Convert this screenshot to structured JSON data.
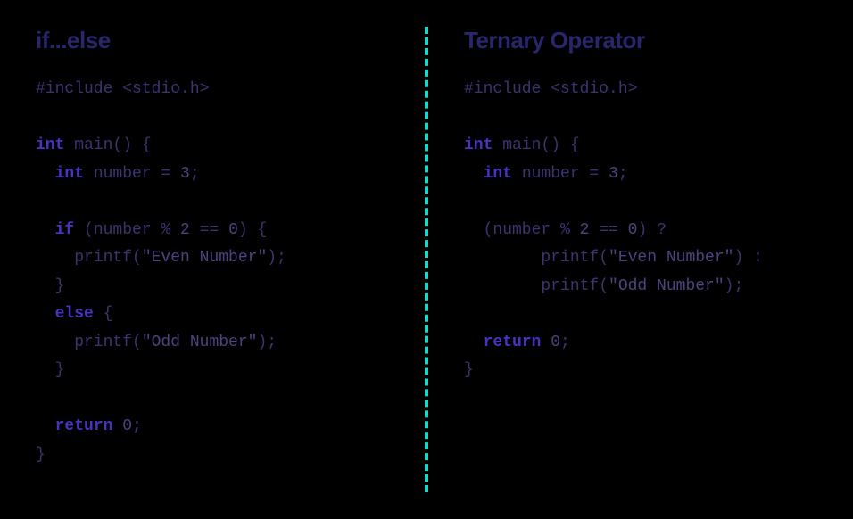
{
  "left": {
    "title": "if...else",
    "code": {
      "include": "#include <stdio.h>",
      "kw_int1": "int",
      "main_sig": " main() {",
      "kw_int2": "int",
      "var_decl": " number = ",
      "num_3": "3",
      "semi": ";",
      "kw_if": "if",
      "if_cond": " (number % ",
      "num_2": "2",
      "cond_mid": " == ",
      "num_0": "0",
      "cond_end": ") {",
      "printf1_a": "    printf(",
      "str_even": "\"Even Number\"",
      "printf1_b": ");",
      "close_if": "  }",
      "kw_else": "else",
      "else_open": " {",
      "printf2_a": "    printf(",
      "str_odd": "\"Odd Number\"",
      "printf2_b": ");",
      "close_else": "  }",
      "kw_return": "return",
      "ret_val": " ",
      "num_0b": "0",
      "ret_end": ";",
      "close_main": "}"
    }
  },
  "right": {
    "title": "Ternary Operator",
    "code": {
      "include": "#include <stdio.h>",
      "kw_int1": "int",
      "main_sig": " main() {",
      "kw_int2": "int",
      "var_decl": " number = ",
      "num_3": "3",
      "semi": ";",
      "cond_open": "  (number % ",
      "num_2": "2",
      "cond_mid": " == ",
      "num_0": "0",
      "cond_end": ") ?",
      "printf1_a": "        printf(",
      "str_even": "\"Even Number\"",
      "printf1_b": ") :",
      "printf2_a": "        printf(",
      "str_odd": "\"Odd Number\"",
      "printf2_b": ");",
      "kw_return": "return",
      "ret_val": " ",
      "num_0b": "0",
      "ret_end": ";",
      "close_main": "}"
    }
  }
}
